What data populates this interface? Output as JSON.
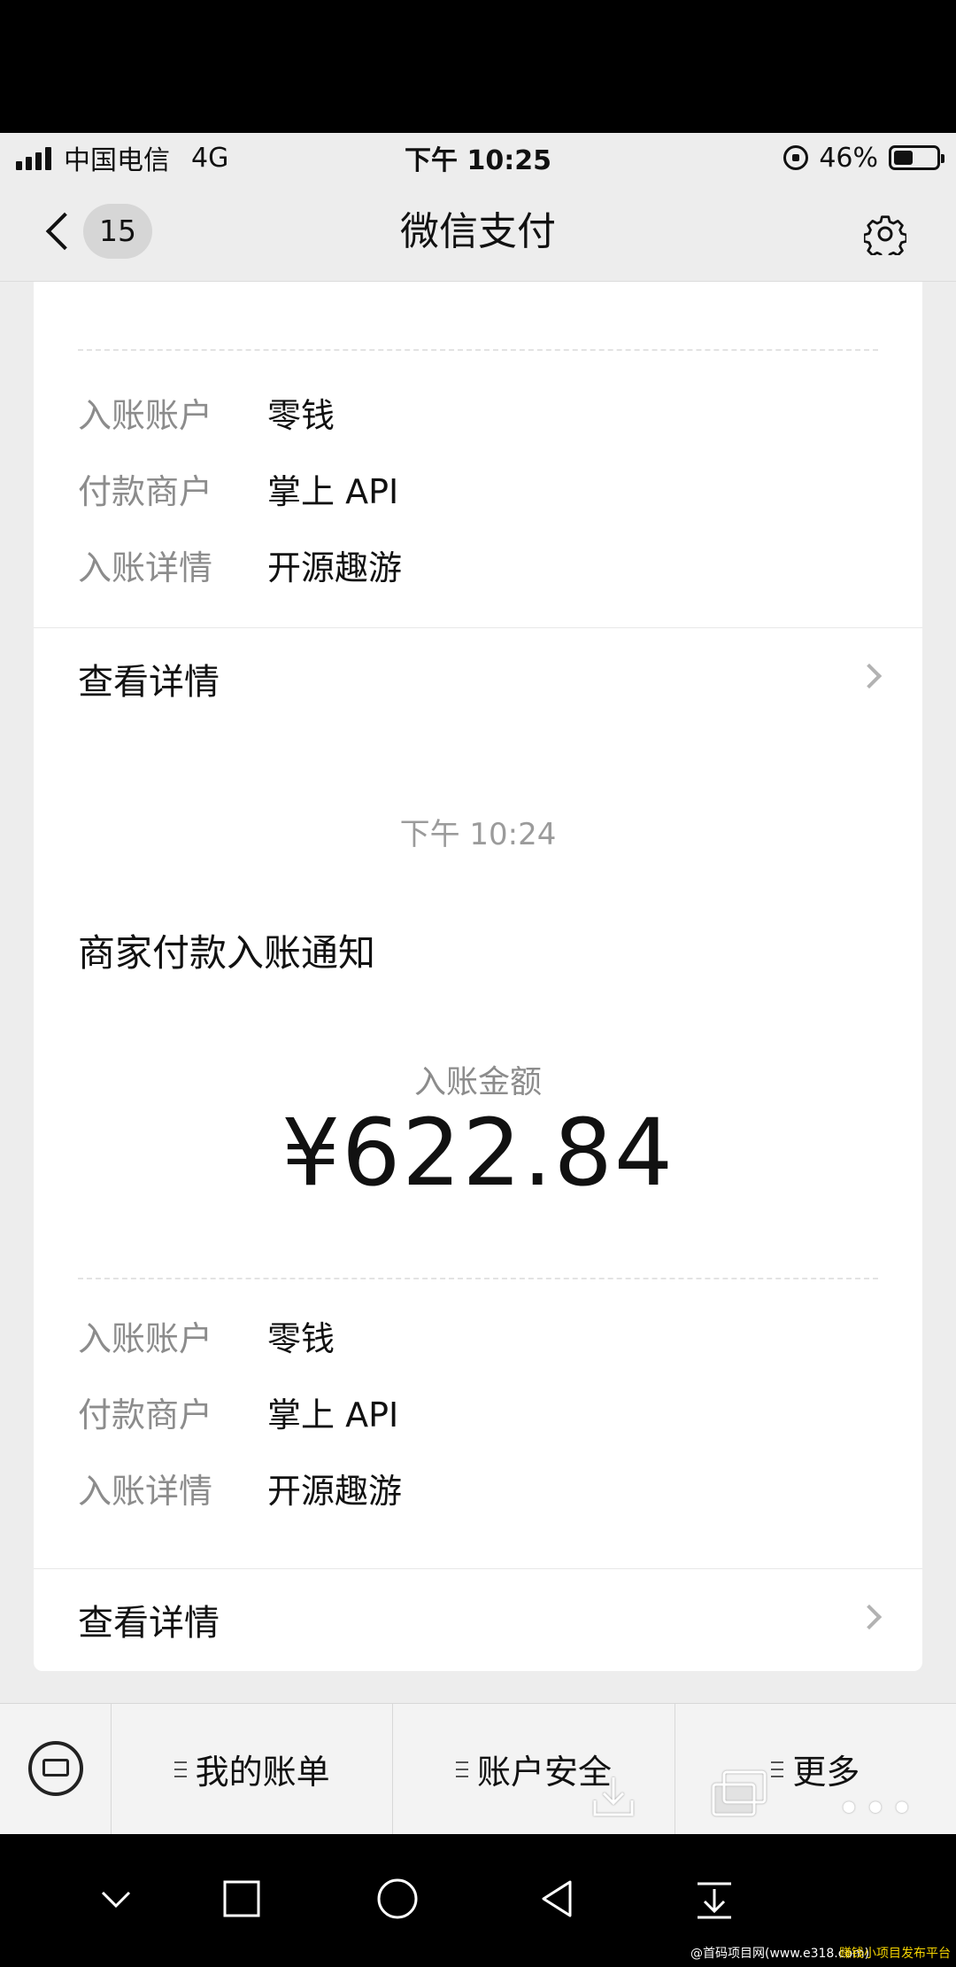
{
  "status_bar": {
    "carrier": "中国电信",
    "network": "4G",
    "time": "下午 10:25",
    "battery": "46%",
    "battery_level": 0.46
  },
  "nav": {
    "unread_count": "15",
    "title": "微信支付",
    "back_icon": "chevron-left-icon",
    "settings_icon": "gear-icon"
  },
  "messages": [
    {
      "fields": [
        {
          "key": "入账账户",
          "value": "零钱"
        },
        {
          "key": "付款商户",
          "value": "掌上 API"
        },
        {
          "key": "入账详情",
          "value": "开源趣游"
        }
      ],
      "link": "查看详情"
    },
    {
      "timestamp": "下午 10:24",
      "title": "商家付款入账通知",
      "amount_label": "入账金额",
      "amount": "¥622.84",
      "fields": [
        {
          "key": "入账账户",
          "value": "零钱"
        },
        {
          "key": "付款商户",
          "value": "掌上 API"
        },
        {
          "key": "入账详情",
          "value": "开源趣游"
        }
      ],
      "link": "查看详情"
    }
  ],
  "menu": {
    "items": [
      "我的账单",
      "账户安全",
      "更多"
    ]
  },
  "overlay": {
    "more": "•••"
  },
  "watermark": {
    "left": "@首码项目网(www.e318.com)",
    "right": "赚钱小项目发布平台",
    "right_color": "#f5d400"
  }
}
